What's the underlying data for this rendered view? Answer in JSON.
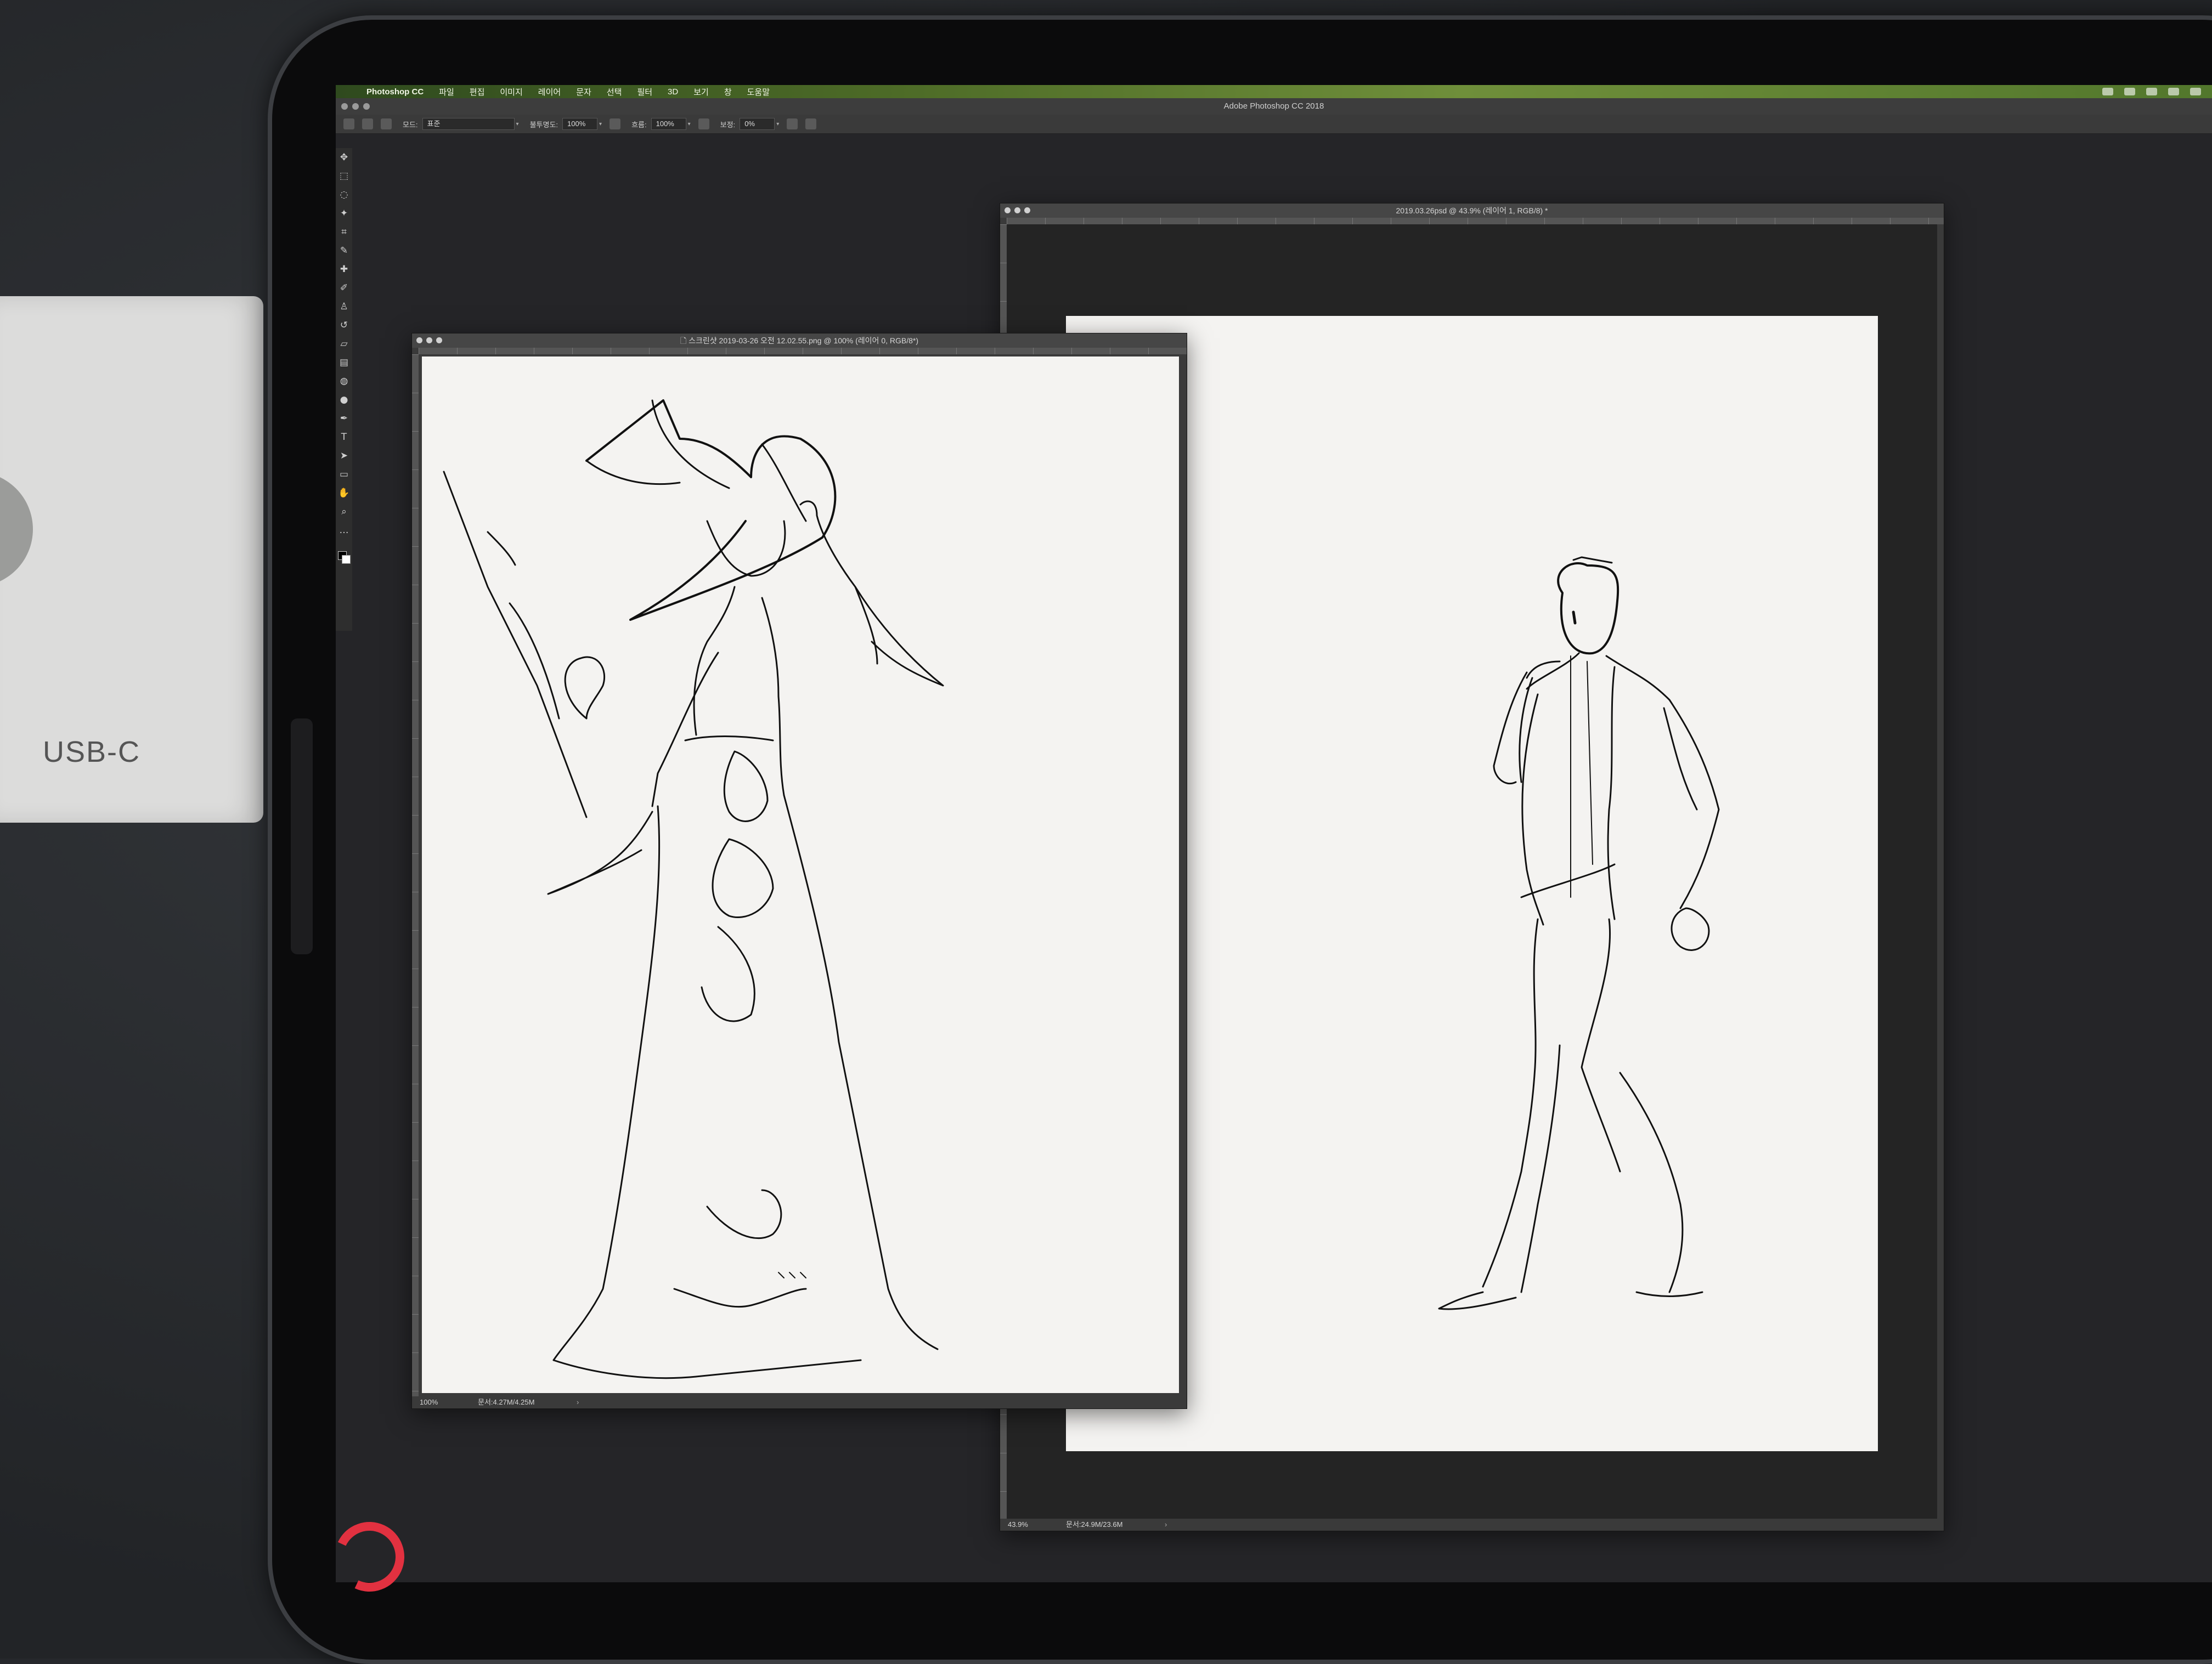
{
  "box": {
    "label": "USB-C"
  },
  "menubar": {
    "app_name": "Photoshop CC",
    "items": [
      "파일",
      "편집",
      "이미지",
      "레이어",
      "문자",
      "선택",
      "필터",
      "3D",
      "보기",
      "창",
      "도움말"
    ]
  },
  "app": {
    "title": "Adobe Photoshop CC 2018"
  },
  "options": {
    "mode_label": "모드:",
    "mode_value": "표준",
    "opacity_label": "불투명도:",
    "opacity_value": "100%",
    "flow_label": "흐름:",
    "flow_value": "100%",
    "smoothing_label": "보정:",
    "smoothing_value": "0%"
  },
  "tools": [
    {
      "name": "move-tool-icon",
      "glyph": "✥"
    },
    {
      "name": "marquee-tool-icon",
      "glyph": "⬚"
    },
    {
      "name": "lasso-tool-icon",
      "glyph": "◌"
    },
    {
      "name": "magic-wand-tool-icon",
      "glyph": "✦"
    },
    {
      "name": "crop-tool-icon",
      "glyph": "⌗"
    },
    {
      "name": "eyedropper-tool-icon",
      "glyph": "✎"
    },
    {
      "name": "healing-brush-tool-icon",
      "glyph": "✚"
    },
    {
      "name": "brush-tool-icon",
      "glyph": "✐"
    },
    {
      "name": "clone-stamp-tool-icon",
      "glyph": "♙"
    },
    {
      "name": "history-brush-tool-icon",
      "glyph": "↺"
    },
    {
      "name": "eraser-tool-icon",
      "glyph": "▱"
    },
    {
      "name": "gradient-tool-icon",
      "glyph": "▤"
    },
    {
      "name": "blur-tool-icon",
      "glyph": "◍"
    },
    {
      "name": "dodge-tool-icon",
      "glyph": "●"
    },
    {
      "name": "pen-tool-icon",
      "glyph": "✒"
    },
    {
      "name": "type-tool-icon",
      "glyph": "T"
    },
    {
      "name": "path-selection-tool-icon",
      "glyph": "➤"
    },
    {
      "name": "rectangle-tool-icon",
      "glyph": "▭"
    },
    {
      "name": "hand-tool-icon",
      "glyph": "✋"
    },
    {
      "name": "zoom-tool-icon",
      "glyph": "⌕"
    },
    {
      "name": "more-tools-icon",
      "glyph": "…"
    }
  ],
  "doc_left": {
    "title": "스크린샷 2019-03-26 오전 12.02.55.png @ 100% (레이어 0, RGB/8*)",
    "zoom": "100%",
    "info": "문서:4.27M/4.25M"
  },
  "doc_right": {
    "title": "2019.03.26psd @ 43.9% (레이어 1, RGB/8) *",
    "zoom": "43.9%",
    "info": "문서:24.9M/23.6M"
  },
  "colors": {
    "menubar_accent": "#5a7f2e",
    "panel_bg": "#3a3a3a",
    "canvas_bg": "#f4f3f1",
    "pencil_ring": "#e23140"
  }
}
